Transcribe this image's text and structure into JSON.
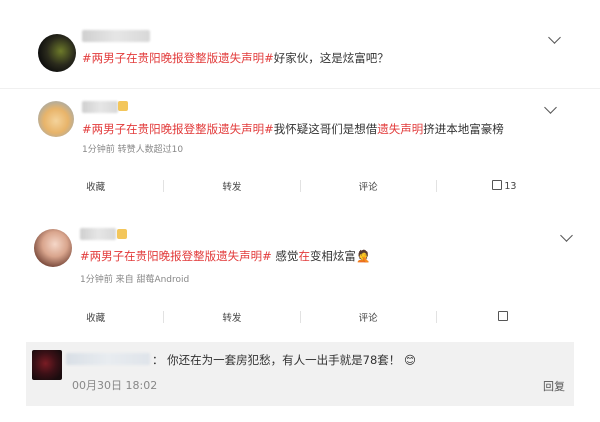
{
  "comments": [
    {
      "tag": "#两男子在贵阳晚报登整版遗失声明#",
      "text": "好家伙，这是炫富吧？"
    },
    {
      "tag": "#两男子在贵阳晚报登整版遗失声明#",
      "text_pre": "我怀疑这哥们是想借",
      "text_hl": "遗失声明",
      "text_post": "挤进本地富豪榜",
      "meta": "1分钟前  转赞人数超过10",
      "actions": {
        "fav": "收藏",
        "share": "转发",
        "comment": "评论",
        "like_count": "13"
      }
    },
    {
      "tag": "#两男子在贵阳晚报登整版遗失声明#",
      "text_pre": " 感觉",
      "text_hl": "在",
      "text_post": "变相炫富",
      "emoji": "🤦",
      "meta": "1分钟前  来自 甜莓Android",
      "actions": {
        "fav": "收藏",
        "share": "转发",
        "comment": "评论"
      }
    }
  ],
  "reply": {
    "text": "：  你还在为一套房犯愁，有人一出手就是78套！",
    "emoji": "😊",
    "time": "00月30日 18:02",
    "reply_label": "回复"
  }
}
